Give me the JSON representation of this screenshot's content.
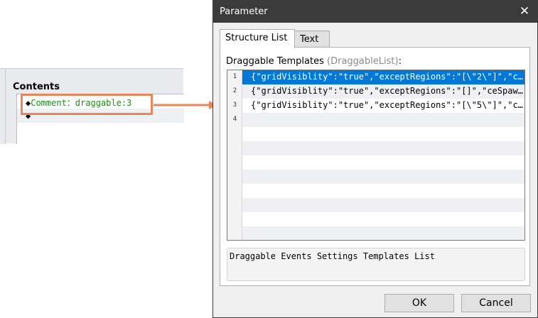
{
  "editor": {
    "contents_label": "Contents",
    "commands": [
      {
        "text": "◆Comment：draggable:3",
        "prefix": "◆",
        "body": "Comment：draggable:3"
      },
      {
        "text": "◆"
      }
    ],
    "comment_color": "#1a8c1a",
    "highlight_color": "#e8855a"
  },
  "dialog": {
    "title": "Parameter",
    "close_icon": "close-icon",
    "tabs": [
      {
        "label": "Structure List",
        "active": true
      },
      {
        "label": "Text",
        "active": false
      }
    ],
    "list_label": "Draggable Templates",
    "list_sublabel": "(DraggableList)",
    "list_colon": ":",
    "rows": [
      {
        "num": "1",
        "value": "{\"gridVisiblity\":\"true\",\"exceptRegions\":\"[\\\"2\\\"]\",\"c…",
        "selected": true
      },
      {
        "num": "2",
        "value": "{\"gridVisiblity\":\"true\",\"exceptRegions\":\"[]\",\"ceSpaw…",
        "selected": false
      },
      {
        "num": "3",
        "value": "{\"gridVisiblity\":\"true\",\"exceptRegions\":\"[\\\"5\\\"]\",\"c…",
        "selected": false
      },
      {
        "num": "4",
        "value": "",
        "selected": false
      }
    ],
    "description": "Draggable Events Settings Templates List",
    "ok_label": "OK",
    "cancel_label": "Cancel",
    "selection_color": "#0078d7"
  }
}
